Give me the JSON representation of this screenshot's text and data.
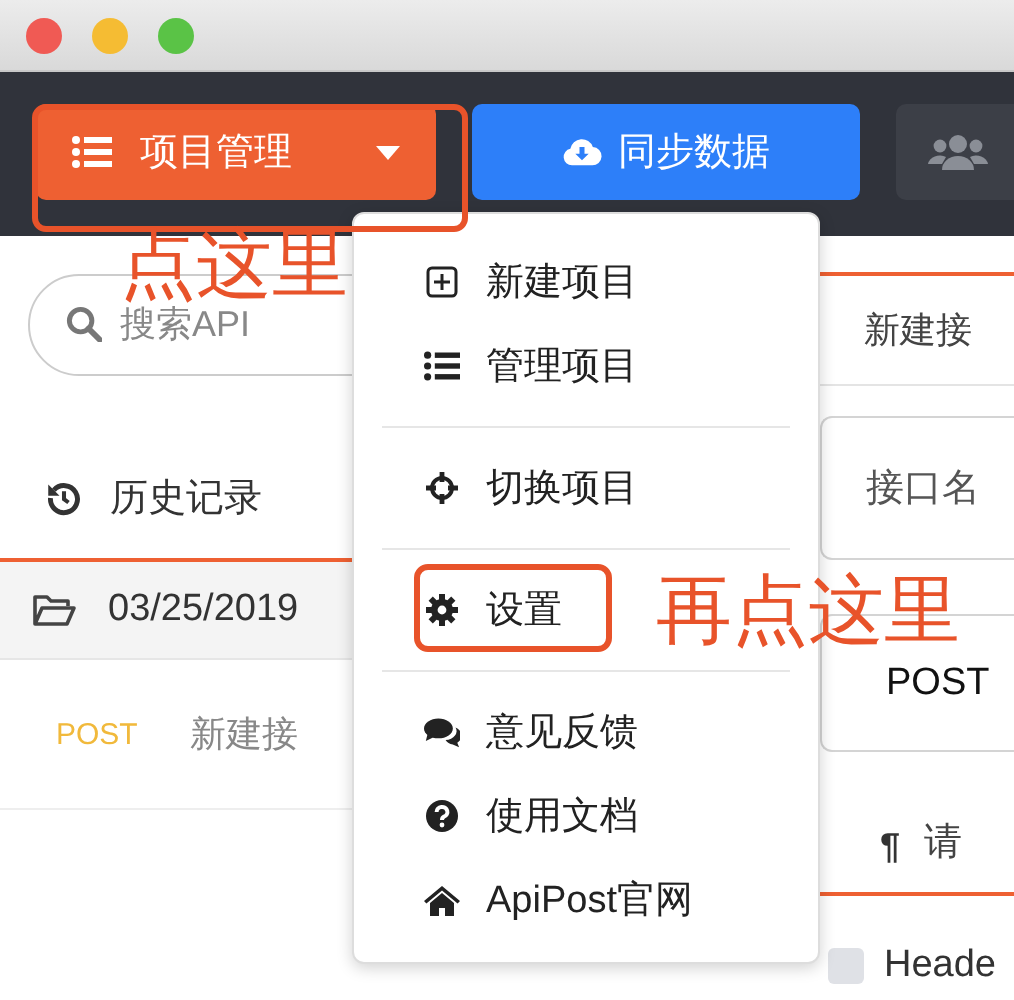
{
  "toolbar": {
    "buttons": [
      {
        "kind": "dropdown",
        "label": "项目管理"
      },
      {
        "kind": "primary",
        "label": "同步数据"
      },
      {
        "kind": "icon"
      }
    ]
  },
  "sidebar": {
    "search": {
      "placeholder": "搜索API"
    },
    "history_label": "历史记录",
    "groups": [
      {
        "date": "03/25/2019",
        "expanded": true,
        "items": [
          {
            "method": "POST",
            "name": "新建接"
          }
        ]
      }
    ]
  },
  "menu": {
    "groups": [
      [
        {
          "label": "新建项目"
        },
        {
          "label": "管理项目"
        }
      ],
      [
        {
          "label": "切换项目"
        }
      ],
      [
        {
          "label": "设置"
        }
      ],
      [
        {
          "label": "意见反馈"
        },
        {
          "label": "使用文档"
        },
        {
          "label": "ApiPost官网"
        }
      ]
    ]
  },
  "request": {
    "title": "新建接",
    "name_field": {
      "placeholder": "接口名"
    },
    "method": "POST",
    "section": {
      "icon": "¶",
      "label": "请"
    },
    "header": {
      "checked": false,
      "label": "Heade"
    }
  },
  "annotations": [
    {
      "text": "点这里"
    },
    {
      "text": "再点这里"
    }
  ]
}
